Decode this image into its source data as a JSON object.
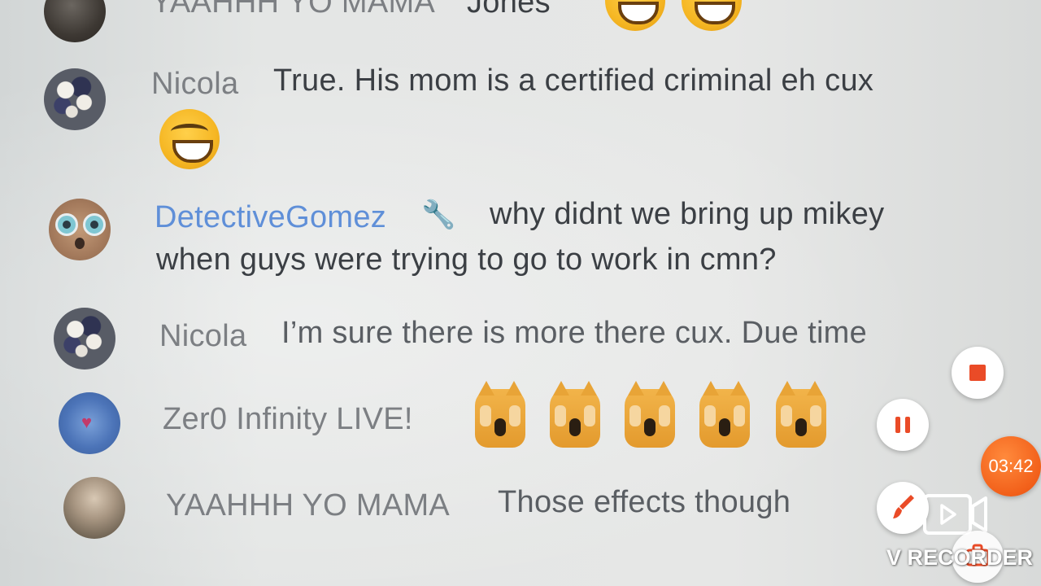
{
  "chat": {
    "messages": [
      {
        "name": "YAAHHH YO MAMA",
        "text": "Jones",
        "emojis": [
          "laughing-face",
          "laughing-face"
        ]
      },
      {
        "name": "Nicola",
        "text": "True. His mom is a certified criminal eh cux",
        "emojis": [
          "laughing-face"
        ]
      },
      {
        "name": "DetectiveGomez",
        "line1": "why didnt we bring up mikey",
        "line2": "when guys were trying to go to work in cmn?",
        "badge": "wrench-icon"
      },
      {
        "name": "Nicola",
        "text": "I’m sure there is more there cux. Due time"
      },
      {
        "name": "Zer0 Infinity LIVE!",
        "emojis": [
          "weary-cat",
          "weary-cat",
          "weary-cat",
          "weary-cat",
          "weary-cat"
        ]
      },
      {
        "name": "YAAHHH YO MAMA",
        "text": "Those effects though"
      }
    ]
  },
  "recorder": {
    "timer": "03:42",
    "logo": "V RECORDER",
    "accent": "#ea4b27",
    "timer_color": "#f2601a"
  }
}
